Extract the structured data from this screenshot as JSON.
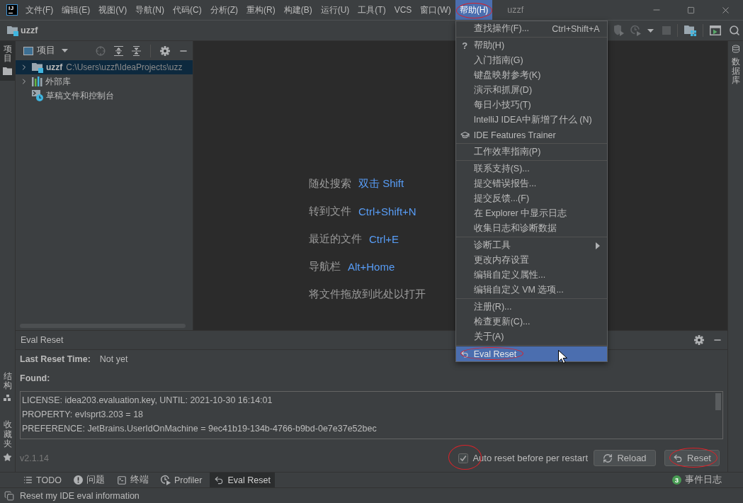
{
  "app_logo": "IJ",
  "menubar": [
    {
      "label": "文件(F)",
      "selected": false,
      "circled": false
    },
    {
      "label": "编辑(E)",
      "selected": false,
      "circled": false
    },
    {
      "label": "视图(V)",
      "selected": false,
      "circled": false
    },
    {
      "label": "导航(N)",
      "selected": false,
      "circled": false
    },
    {
      "label": "代码(C)",
      "selected": false,
      "circled": false
    },
    {
      "label": "分析(Z)",
      "selected": false,
      "circled": false
    },
    {
      "label": "重构(R)",
      "selected": false,
      "circled": false
    },
    {
      "label": "构建(B)",
      "selected": false,
      "circled": false
    },
    {
      "label": "运行(U)",
      "selected": false,
      "circled": false
    },
    {
      "label": "工具(T)",
      "selected": false,
      "circled": false
    },
    {
      "label": "VCS",
      "selected": false,
      "circled": false
    },
    {
      "label": "窗口(W)",
      "selected": false,
      "circled": false
    },
    {
      "label": "帮助(H)",
      "selected": true,
      "circled": true
    }
  ],
  "window_title": "uzzf",
  "navbar": {
    "project": "uzzf"
  },
  "help_menu": {
    "groups": [
      [
        {
          "label": "查找操作(F)...",
          "shortcut": "Ctrl+Shift+A",
          "kind": "action",
          "selected": false,
          "circled": false
        }
      ],
      [
        {
          "label": "帮助(H)",
          "icon": "?",
          "kind": "help",
          "selected": false,
          "circled": false
        },
        {
          "label": "入门指南(G)",
          "kind": "action",
          "selected": false,
          "circled": false
        },
        {
          "label": "键盘映射参考(K)",
          "kind": "action",
          "selected": false,
          "circled": false
        },
        {
          "label": "演示和抓屏(D)",
          "kind": "action",
          "selected": false,
          "circled": false
        },
        {
          "label": "每日小技巧(T)",
          "kind": "action",
          "selected": false,
          "circled": false
        },
        {
          "label": "IntelliJ IDEA中新增了什么 (N)",
          "kind": "action",
          "selected": false,
          "circled": false
        },
        {
          "label": "IDE Features Trainer",
          "kind": "trainer",
          "selected": false,
          "circled": false
        }
      ],
      [
        {
          "label": "工作效率指南(P)",
          "kind": "action",
          "selected": false,
          "circled": false
        }
      ],
      [
        {
          "label": "联系支持(S)...",
          "kind": "action",
          "selected": false,
          "circled": false
        },
        {
          "label": "提交错误报告...",
          "kind": "action",
          "selected": false,
          "circled": false
        },
        {
          "label": "提交反馈...(F)",
          "kind": "action",
          "selected": false,
          "circled": false
        },
        {
          "label": "在 Explorer 中显示日志",
          "kind": "action",
          "selected": false,
          "circled": false
        },
        {
          "label": "收集日志和诊断数据",
          "kind": "action",
          "selected": false,
          "circled": false
        }
      ],
      [
        {
          "label": "诊断工具",
          "kind": "submenu",
          "selected": false,
          "circled": false
        },
        {
          "label": "更改内存设置",
          "kind": "action",
          "selected": false,
          "circled": false
        },
        {
          "label": "编辑自定义属性...",
          "kind": "action",
          "selected": false,
          "circled": false
        },
        {
          "label": "编辑自定义 VM 选项...",
          "kind": "action",
          "selected": false,
          "circled": false
        }
      ],
      [
        {
          "label": "注册(R)...",
          "kind": "action",
          "selected": false,
          "circled": false
        },
        {
          "label": "检查更新(C)...",
          "kind": "action",
          "selected": false,
          "circled": false
        },
        {
          "label": "关于(A)",
          "kind": "action",
          "selected": false,
          "circled": false
        }
      ],
      [
        {
          "label": "Eval Reset",
          "kind": "reset",
          "selected": true,
          "circled": true
        }
      ]
    ]
  },
  "left_strip": {
    "top": [
      {
        "label": "项目",
        "kind": "project",
        "selected": true
      }
    ],
    "bottom": [
      {
        "label": "结构",
        "kind": "structure",
        "selected": false
      },
      {
        "label": "收藏夹",
        "kind": "favorites",
        "selected": false
      }
    ]
  },
  "right_strip": {
    "tabs": [
      {
        "label": "数据库",
        "kind": "database",
        "selected": false
      }
    ]
  },
  "project_panel": {
    "title": "项目",
    "tree": [
      {
        "name": "uzzf",
        "path": "C:\\Users\\uzzf\\IdeaProjects\\uzz",
        "kind": "module",
        "expanded": false,
        "selected": true
      },
      {
        "name": "外部库",
        "kind": "library",
        "expanded": false,
        "selected": false
      },
      {
        "name": "草稿文件和控制台",
        "kind": "scratch",
        "selected": false
      }
    ]
  },
  "editor_hints": [
    {
      "label": "随处搜索",
      "shortcut": "双击 Shift"
    },
    {
      "label": "转到文件",
      "shortcut": "Ctrl+Shift+N"
    },
    {
      "label": "最近的文件",
      "shortcut": "Ctrl+E"
    },
    {
      "label": "导航栏",
      "shortcut": "Alt+Home"
    },
    {
      "label": "将文件拖放到此处以打开"
    }
  ],
  "tool_window": {
    "title": "Eval Reset",
    "last_reset_label": "Last Reset Time:",
    "last_reset_value": "Not yet",
    "found_label": "Found:",
    "found_lines": [
      "LICENSE: idea203.evaluation.key, UNTIL: 2021-10-30 16:14:01",
      "PROPERTY: evlsprt3.203 = 18",
      "PREFERENCE: JetBrains.UserIdOnMachine = 9ec41b19-134b-4766-b9bd-0e7e37e52bec"
    ],
    "version": "v2.1.14",
    "auto_reset": {
      "label": "Auto reset before per restart",
      "checked": true,
      "circled": true
    },
    "buttons": [
      {
        "label": "Reload",
        "kind": "reload",
        "circled": false
      },
      {
        "label": "Reset",
        "kind": "reset",
        "circled": true
      }
    ]
  },
  "bottom_tabs": [
    {
      "label": "TODO",
      "kind": "todo",
      "selected": false
    },
    {
      "label": "问题",
      "kind": "problems",
      "selected": false
    },
    {
      "label": "终端",
      "kind": "terminal",
      "selected": false
    },
    {
      "label": "Profiler",
      "kind": "profiler",
      "selected": false
    },
    {
      "label": "Eval Reset",
      "kind": "reset",
      "selected": true
    }
  ],
  "event_log": {
    "count": "3",
    "label": "事件日志"
  },
  "status_bar": {
    "message": "Reset my IDE eval information"
  }
}
